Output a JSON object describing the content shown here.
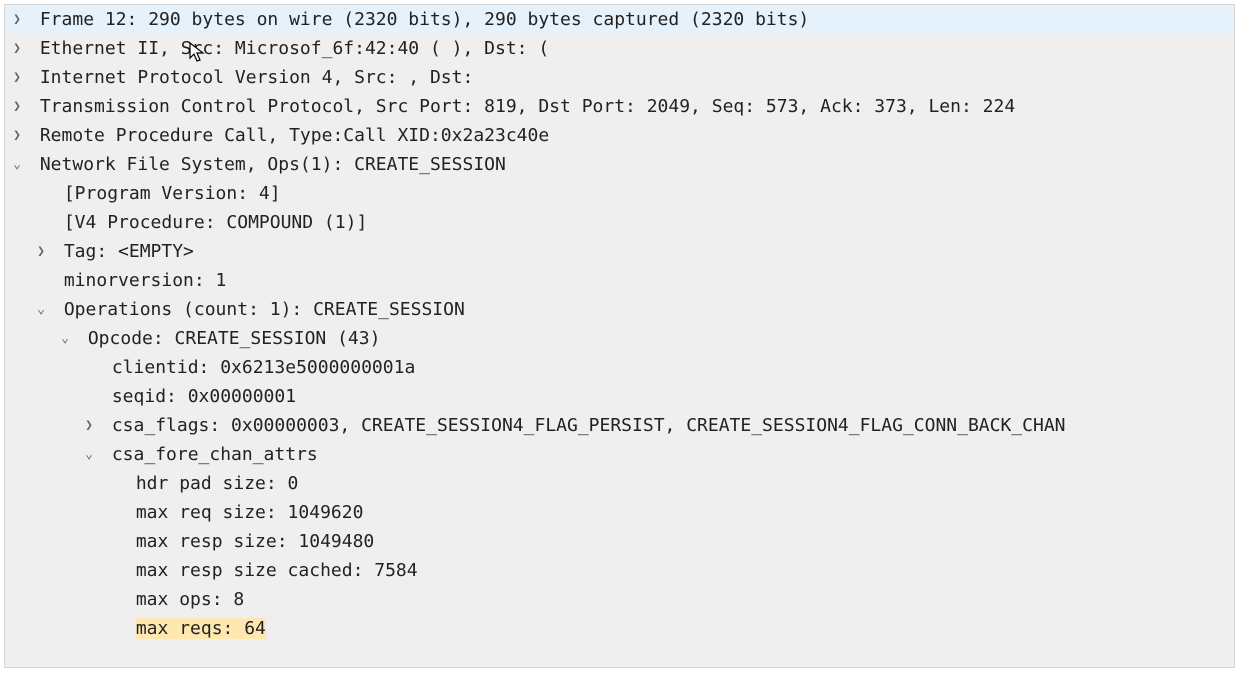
{
  "rows": {
    "frame": "Frame 12: 290 bytes on wire (2320 bits), 290 bytes captured (2320 bits)",
    "ethernet": "Ethernet II, Src: Microsof_6f:42:40 (                  ), Dst:                      (",
    "ipv4": "Internet Protocol Version 4, Src:          , Dst:",
    "tcp": "Transmission Control Protocol, Src Port: 819, Dst Port: 2049, Seq: 573, Ack: 373, Len: 224",
    "rpc": "Remote Procedure Call, Type:Call XID:0x2a23c40e",
    "nfs": "Network File System, Ops(1): CREATE_SESSION",
    "progver": "[Program Version: 4]",
    "v4proc": "[V4 Procedure: COMPOUND (1)]",
    "tag": "Tag: <EMPTY>",
    "minorver": "minorversion: 1",
    "operations": "Operations (count: 1): CREATE_SESSION",
    "opcode": "Opcode: CREATE_SESSION (43)",
    "clientid": "clientid: 0x6213e5000000001a",
    "seqid": "seqid: 0x00000001",
    "csa_flags": "csa_flags: 0x00000003, CREATE_SESSION4_FLAG_PERSIST, CREATE_SESSION4_FLAG_CONN_BACK_CHAN",
    "csa_fore": "csa_fore_chan_attrs",
    "hdrpad": "hdr pad size: 0",
    "maxreqsize": "max req size: 1049620",
    "maxrespsize": "max resp size: 1049480",
    "maxrespcached": "max resp size cached: 7584",
    "maxops": "max ops: 8",
    "maxreqs": "max reqs: 64"
  },
  "glyphs": {
    "collapsed": "❯",
    "expanded": "⌄"
  }
}
